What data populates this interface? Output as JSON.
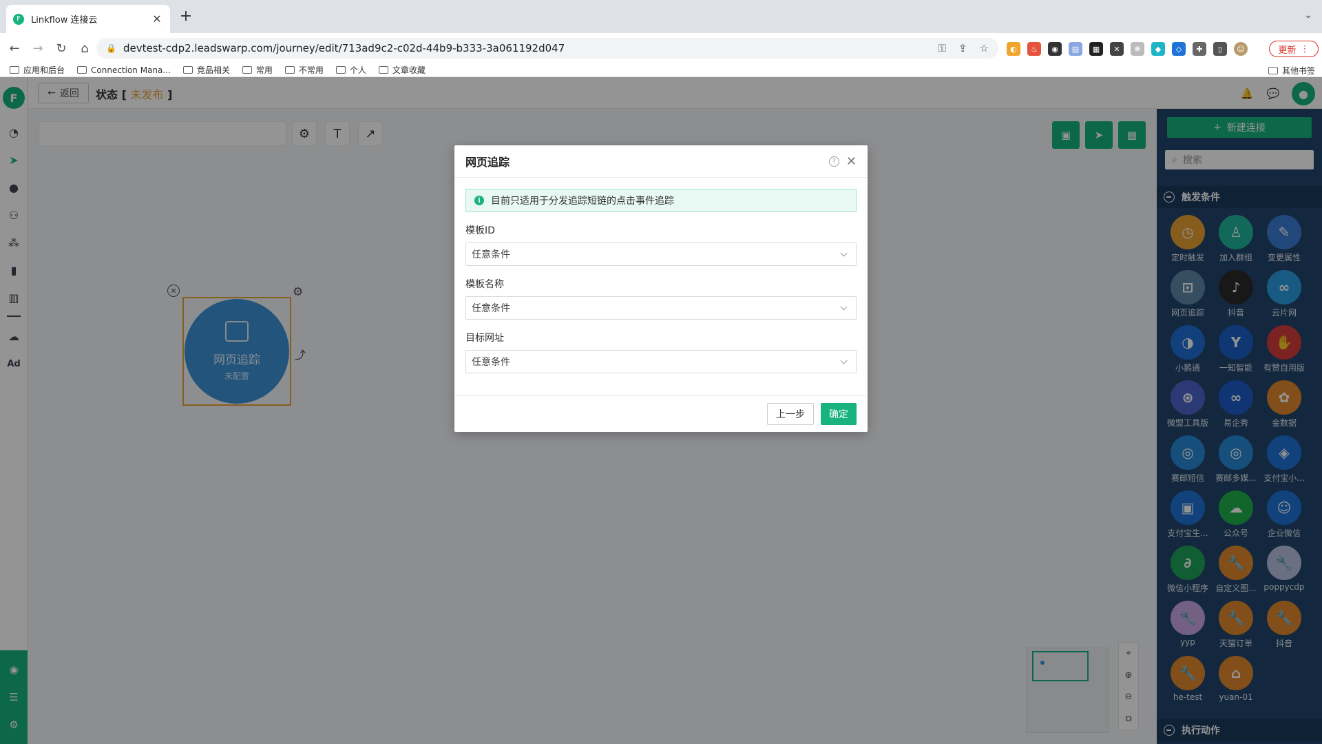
{
  "browser": {
    "tab_title": "Linkflow 连接云",
    "tab_close": "✕",
    "new_tab": "+",
    "url": "devtest-cdp2.leadswarp.com/journey/edit/713ad9c2-c02d-44b9-b333-3a061192d047",
    "update_label": "更新",
    "bookmarks": [
      "应用和后台",
      "Connection Mana...",
      "竞品相关",
      "常用",
      "不常用",
      "个人",
      "文章收藏"
    ],
    "other_bookmarks": "其他书签"
  },
  "app": {
    "logo_text": "F",
    "back_label": "返回",
    "status_label": "状态",
    "status_value": "未发布",
    "node": {
      "label": "网页追踪",
      "sub": "未配置"
    },
    "sidebar": {
      "new_connection": "新建连接",
      "search_placeholder": "搜索",
      "section_trigger": "触发条件",
      "section_action": "执行动作",
      "items": [
        {
          "label": "定时触发",
          "color": "#e8a035",
          "glyph": "◷"
        },
        {
          "label": "加入群组",
          "color": "#1fb59a",
          "glyph": "♙"
        },
        {
          "label": "变更属性",
          "color": "#3a7bd5",
          "glyph": "✎"
        },
        {
          "label": "网页追踪",
          "color": "#5f87a8",
          "glyph": "⊡"
        },
        {
          "label": "抖音",
          "color": "#2a2a2a",
          "glyph": "♪"
        },
        {
          "label": "云片网",
          "color": "#2c9be0",
          "glyph": "∞"
        },
        {
          "label": "小鹅通",
          "color": "#1f6fd6",
          "glyph": "◑"
        },
        {
          "label": "一知智能",
          "color": "#1a5fc9",
          "glyph": "Y"
        },
        {
          "label": "有赞自用版",
          "color": "#d43b3b",
          "glyph": "✋"
        },
        {
          "label": "微盟工具版",
          "color": "#4a63c8",
          "glyph": "⊛"
        },
        {
          "label": "易企秀",
          "color": "#1e5cc8",
          "glyph": "∞"
        },
        {
          "label": "金数据",
          "color": "#e0892e",
          "glyph": "✿"
        },
        {
          "label": "赛邮短信",
          "color": "#2689d6",
          "glyph": "◎"
        },
        {
          "label": "赛邮多媒...",
          "color": "#2689d6",
          "glyph": "◎"
        },
        {
          "label": "支付宝小...",
          "color": "#1f73d6",
          "glyph": "◈"
        },
        {
          "label": "支付宝生...",
          "color": "#1f73d6",
          "glyph": "▣"
        },
        {
          "label": "公众号",
          "color": "#1fae4a",
          "glyph": "☁"
        },
        {
          "label": "企业微信",
          "color": "#1f73d6",
          "glyph": "☺"
        },
        {
          "label": "微信小程序",
          "color": "#1fa35a",
          "glyph": "∂"
        },
        {
          "label": "自定义图...",
          "color": "#e0892e",
          "glyph": "🔧"
        },
        {
          "label": "poppycdp",
          "color": "#b7bfe0",
          "glyph": "🔧"
        },
        {
          "label": "yyp",
          "color": "#c7a6e0",
          "glyph": "🔧"
        },
        {
          "label": "天猫订单",
          "color": "#e0892e",
          "glyph": "🔧"
        },
        {
          "label": "抖音",
          "color": "#e0892e",
          "glyph": "🔧"
        },
        {
          "label": "he-test",
          "color": "#e0892e",
          "glyph": "🔧"
        },
        {
          "label": "yuan-01",
          "color": "#e0892e",
          "glyph": "⌂"
        }
      ]
    }
  },
  "modal": {
    "title": "网页追踪",
    "notice": "目前只适用于分发追踪短链的点击事件追踪",
    "fields": [
      {
        "label": "模板ID",
        "value": "任意条件"
      },
      {
        "label": "模板名称",
        "value": "任意条件"
      },
      {
        "label": "目标网址",
        "value": "任意条件"
      }
    ],
    "prev_label": "上一步",
    "ok_label": "确定"
  }
}
